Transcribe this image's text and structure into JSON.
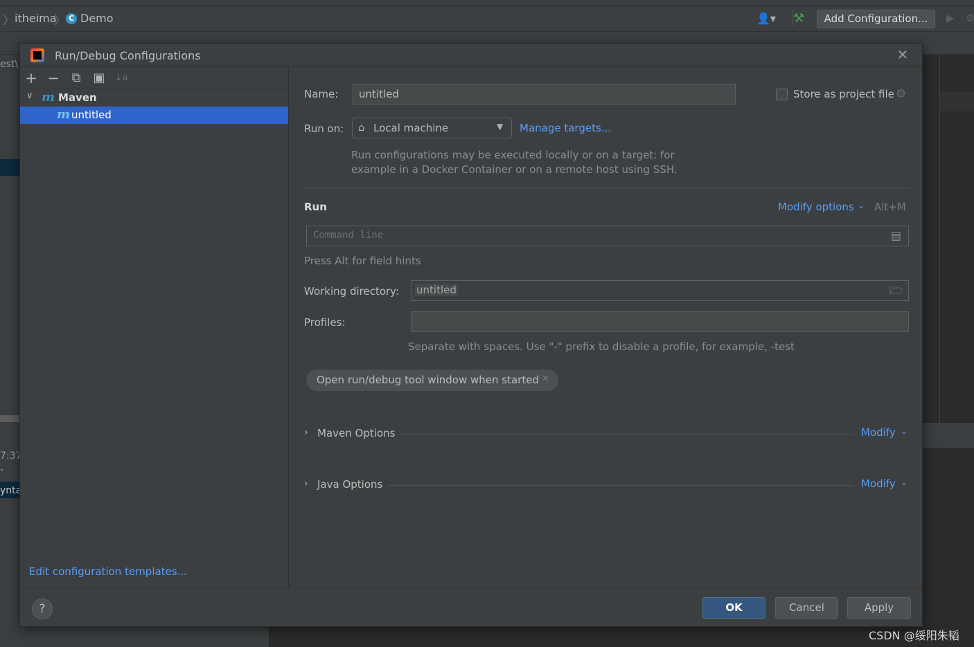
{
  "ide": {
    "breadcrumb": [
      "itheima",
      "Demo"
    ],
    "class_icon_letter": "C",
    "add_configuration_label": "Add Configuration...",
    "left_edge_snippets": [
      "est\\",
      "7:37",
      "-",
      "ynta:"
    ]
  },
  "dialog": {
    "title": "Run/Debug Configurations",
    "toolbar": {
      "add": "+",
      "remove": "−",
      "copy": "⧉",
      "new_folder": "▣",
      "sort": "↓a"
    },
    "tree": {
      "group_label": "Maven",
      "group_icon_letter": "m",
      "selected_label": "untitled",
      "selected_icon_letter": "m"
    },
    "edit_templates_link": "Edit configuration templates...",
    "form": {
      "name_label": "Name:",
      "name_value": "untitled",
      "store_label": "Store as project file",
      "store_checked": false,
      "run_on_label": "Run on:",
      "run_on_value": "Local machine",
      "manage_targets_link": "Manage targets...",
      "run_on_hint_line1": "Run configurations may be executed locally or on a target: for",
      "run_on_hint_line2": "example in a Docker Container or on a remote host using SSH.",
      "run_section_title": "Run",
      "modify_options_link": "Modify options",
      "modify_options_shortcut": "Alt+M",
      "command_line_placeholder": "Command line",
      "field_hint": "Press Alt for field hints",
      "working_dir_label": "Working directory:",
      "working_dir_value": "untitled",
      "profiles_label": "Profiles:",
      "profiles_value": "",
      "profiles_hint": "Separate with spaces. Use \"-\" prefix to disable a profile, for example, -test",
      "chip_label": "Open run/debug tool window when started",
      "maven_options_title": "Maven Options",
      "java_options_title": "Java Options",
      "modify_link": "Modify"
    },
    "buttons": {
      "help": "?",
      "ok": "OK",
      "cancel": "Cancel",
      "apply": "Apply"
    }
  },
  "watermark": "CSDN @绥阳朱韬",
  "colors": {
    "accent_link": "#589df6",
    "selection": "#2f65ca",
    "ok_button": "#365880",
    "dialog_bg": "#3c3f41"
  }
}
